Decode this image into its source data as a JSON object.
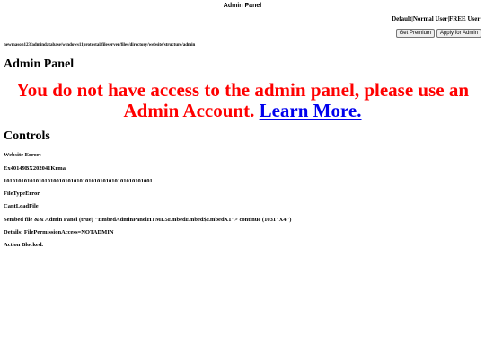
{
  "page": {
    "title": "Admin Panel"
  },
  "account": {
    "types": "Default|Normal User|FREE User|",
    "buttons": {
      "get_premium": "Get Premium",
      "apply_admin": "Apply for Admin"
    }
  },
  "path": "newmason123/admindatabase/windows11protostal/fileserver/files/directory/website/structure/admin",
  "heading": "Admin Panel",
  "access_message": {
    "text": "You do not have access to the admin panel, please use an Admin Account.",
    "link": "Learn More.",
    "color": "#ff0000",
    "link_color": "#0000ee"
  },
  "controls": {
    "heading": "Controls",
    "items": [
      "Website Error:",
      "Ex40149BX202041Krma",
      "101010101010101010010101010101010101010101010101001",
      "FileTypeError",
      "CantLoadFile",
      "Sembed file && Admin Panel (true) \"EmbedAdminPanelHTML5EmbedEmbed$EmbedX1\"> continue (1031\"X4\")",
      "Details: FilePermissionAccess=NOTADMIN",
      "Action Blocked."
    ]
  }
}
